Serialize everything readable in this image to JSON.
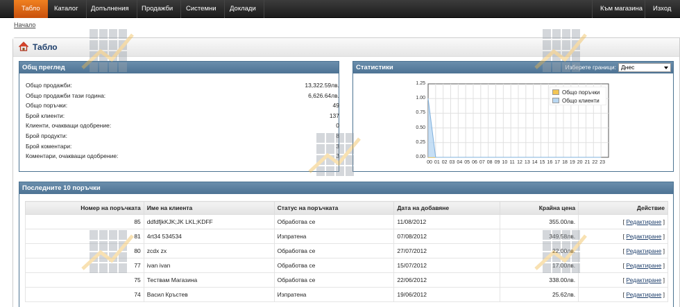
{
  "nav": {
    "items": [
      "Табло",
      "Каталог",
      "Допълнения",
      "Продажби",
      "Системни",
      "Доклади"
    ],
    "active": 0,
    "right_items": [
      "Към магазина",
      "Изход"
    ]
  },
  "breadcrumb": "Начало",
  "page_title": "Табло",
  "overview": {
    "title": "Общ преглед",
    "rows": [
      {
        "label": "Общо продажби:",
        "value": "13,322.59лв."
      },
      {
        "label": "Общо продажби тази година:",
        "value": "6,626.64лв."
      },
      {
        "label": "Общо поръчки:",
        "value": "49"
      },
      {
        "label": "Брой клиенти:",
        "value": "137"
      },
      {
        "label": "Клиенти, очакващи одобрение:",
        "value": "0"
      },
      {
        "label": "Брой продукти:",
        "value": "8"
      },
      {
        "label": "Брой коментари:",
        "value": "3"
      },
      {
        "label": "Коментари, очакващи одобрение:",
        "value": "3"
      }
    ]
  },
  "statistics": {
    "title": "Статистики",
    "range_label": "Изберете граници:",
    "range_value": "Днес"
  },
  "chart_data": {
    "type": "area",
    "x": [
      "00",
      "01",
      "02",
      "03",
      "04",
      "05",
      "06",
      "07",
      "08",
      "09",
      "10",
      "11",
      "12",
      "13",
      "14",
      "15",
      "16",
      "17",
      "18",
      "19",
      "20",
      "21",
      "22",
      "23"
    ],
    "yticks": [
      "1.25",
      "1.00",
      "0.75",
      "0.50",
      "0.25",
      "0.00"
    ],
    "ylim": [
      0,
      1.25
    ],
    "series": [
      {
        "name": "Общо поръчки",
        "color": "#f4c655",
        "values": [
          0,
          0,
          0,
          0,
          0,
          0,
          0,
          0,
          0,
          0,
          0,
          0,
          0,
          0,
          0,
          0,
          0,
          0,
          0,
          0,
          0,
          0,
          0,
          0
        ]
      },
      {
        "name": "Общо клиенти",
        "color": "#b8d7f2",
        "values": [
          1,
          0,
          0,
          0,
          0,
          0,
          0,
          0,
          0,
          0,
          0,
          0,
          0,
          0,
          0,
          0,
          0,
          0,
          0,
          0,
          0,
          0,
          0,
          0
        ]
      }
    ],
    "legend": "top-right",
    "grid": true
  },
  "orders": {
    "title": "Последните 10 поръчки",
    "headers": [
      "Номер на поръчката",
      "Име на клиента",
      "Статус на поръчката",
      "Дата на добавяне",
      "Крайна цена",
      "Действие"
    ],
    "rows": [
      {
        "id": "85",
        "customer": "ddfdfjkKJK;JK LKL;KDFF",
        "status": "Обработва се",
        "date": "11/08/2012",
        "total": "355.00лв.",
        "action": "Редактиране"
      },
      {
        "id": "81",
        "customer": "4rt34 534534",
        "status": "Изпратена",
        "date": "07/08/2012",
        "total": "349.58лв.",
        "action": "Редактиране"
      },
      {
        "id": "80",
        "customer": "zcdx zx",
        "status": "Обработва се",
        "date": "27/07/2012",
        "total": "22.00лв.",
        "action": "Редактиране"
      },
      {
        "id": "77",
        "customer": "ivan ivan",
        "status": "Обработва се",
        "date": "15/07/2012",
        "total": "17.00лв.",
        "action": "Редактиране"
      },
      {
        "id": "75",
        "customer": "Тествам Магазина",
        "status": "Обработва се",
        "date": "22/06/2012",
        "total": "338.00лв.",
        "action": "Редактиране"
      },
      {
        "id": "74",
        "customer": "Васил Кръстев",
        "status": "Изпратена",
        "date": "19/06/2012",
        "total": "25.62лв.",
        "action": "Редактиране"
      }
    ]
  }
}
